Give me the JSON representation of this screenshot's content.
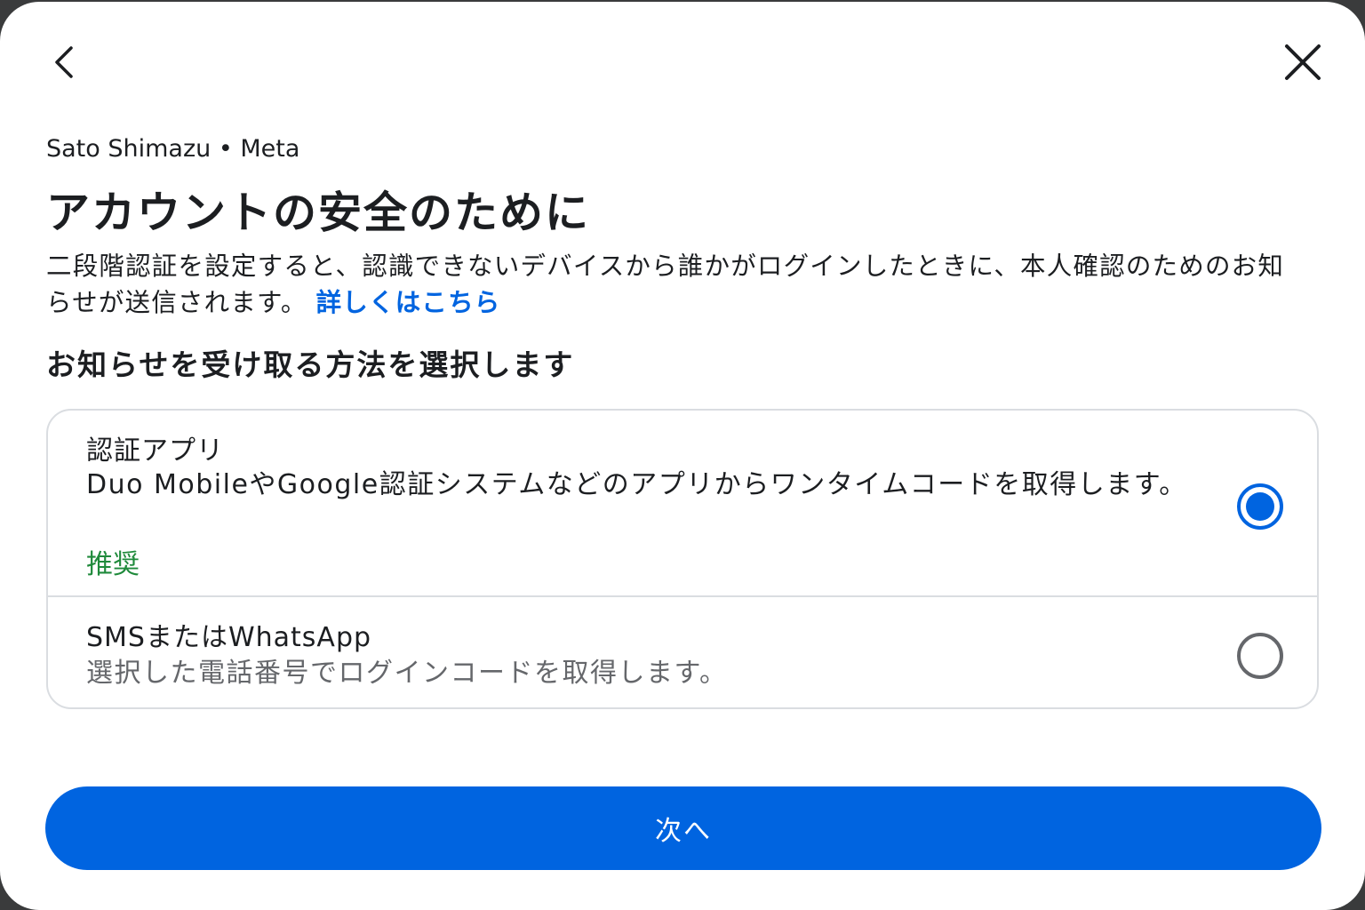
{
  "dialog": {
    "back_icon": "chevron-left-icon",
    "close_icon": "close-icon",
    "account_line": "Sato Shimazu • Meta",
    "title": "アカウントの安全のために",
    "description": "二段階認証を設定すると、認識できないデバイスから誰かがログインしたときに、本人確認のためのお知らせが送信されます。",
    "learn_more": "詳しくはこちら",
    "section_title": "お知らせを受け取る方法を選択します",
    "options": [
      {
        "label": "認証アプリ",
        "description": "Duo MobileやGoogle認証システムなどのアプリからワンタイムコードを取得します。",
        "badge": "推奨",
        "selected": true
      },
      {
        "label": "SMSまたはWhatsApp",
        "description": "選択した電話番号でログインコードを取得します。",
        "selected": false
      }
    ],
    "next_button": "次へ"
  },
  "colors": {
    "accent": "#0064e0",
    "recommend": "#1f8a3b",
    "secondary_text": "#65676b",
    "border": "#dadde1"
  }
}
